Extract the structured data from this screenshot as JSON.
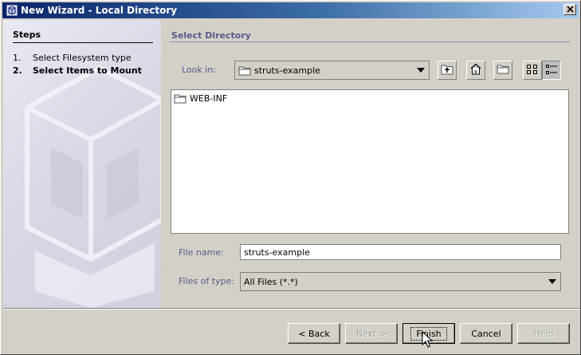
{
  "window": {
    "title": "New Wizard - Local Directory",
    "close_label": "×"
  },
  "steps": {
    "title": "Steps",
    "items": [
      {
        "num": "1.",
        "label": "Select Filesystem type"
      },
      {
        "num": "2.",
        "label": "Select Items to Mount"
      }
    ]
  },
  "main": {
    "title": "Select Directory",
    "look_in_label": "Look in:",
    "look_in_value": "struts-example",
    "files": [
      "WEB-INF"
    ],
    "file_name_label": "File name:",
    "file_name_value": "struts-example",
    "files_of_type_label": "Files of type:",
    "files_of_type_value": "All Files (*.*)"
  },
  "buttons": {
    "back": "< Back",
    "next": "Next >",
    "finish": "Finish",
    "cancel": "Cancel",
    "help": "Help"
  },
  "colors": {
    "title_start": "#0a246a",
    "title_end": "#a6caf0",
    "label": "#5a5a8a"
  }
}
